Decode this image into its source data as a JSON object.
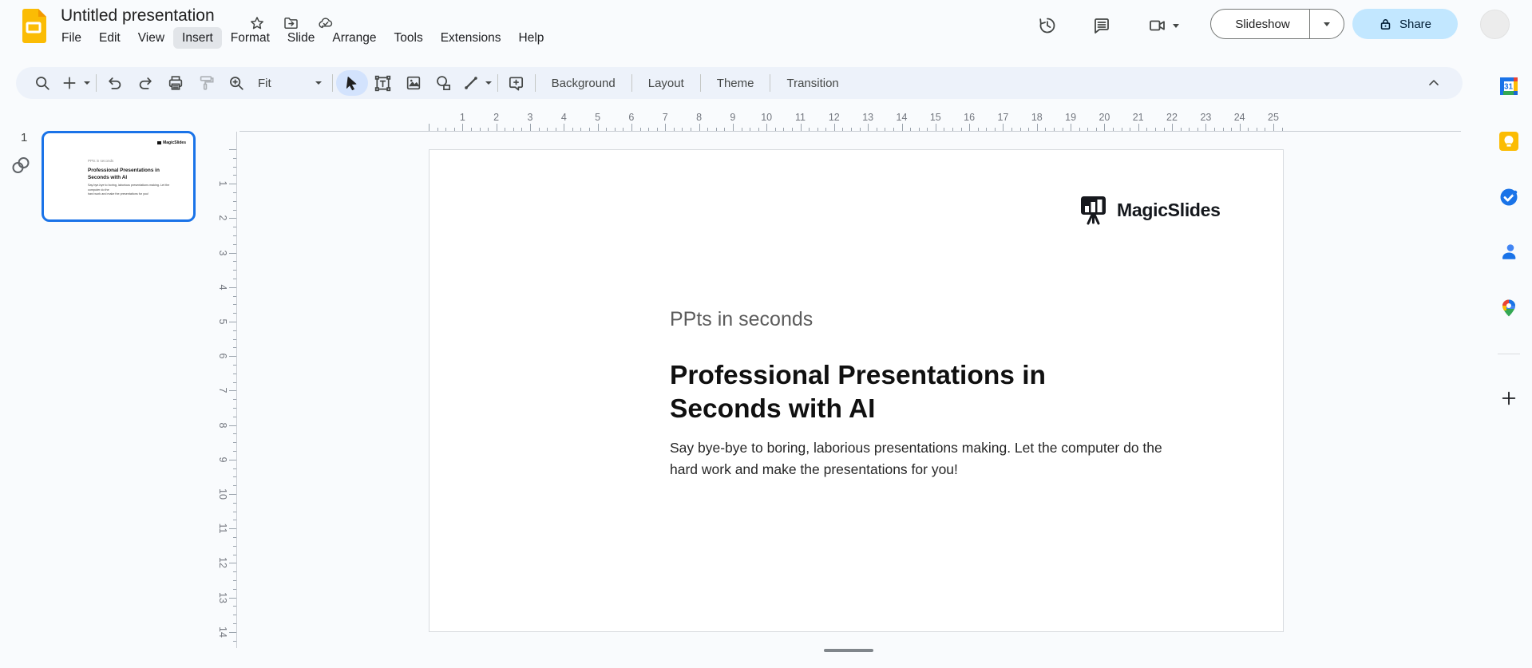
{
  "app": {
    "title": "Untitled presentation"
  },
  "menu": {
    "items": [
      "File",
      "Edit",
      "View",
      "Insert",
      "Format",
      "Slide",
      "Arrange",
      "Tools",
      "Extensions",
      "Help"
    ],
    "active_item": "Insert"
  },
  "header_actions": {
    "slideshow_label": "Slideshow",
    "share_label": "Share"
  },
  "toolbar": {
    "zoom_value": "Fit",
    "background_label": "Background",
    "layout_label": "Layout",
    "theme_label": "Theme",
    "transition_label": "Transition"
  },
  "filmstrip": {
    "slide_number": "1"
  },
  "rulers": {
    "horizontal_numbers": [
      1,
      2,
      3,
      4,
      5,
      6,
      7,
      8,
      9,
      10,
      11,
      12,
      13,
      14,
      15,
      16,
      17,
      18,
      19,
      20,
      21,
      22,
      23,
      24,
      25
    ],
    "vertical_numbers": [
      1,
      2,
      3,
      4,
      5,
      6,
      7,
      8,
      9,
      10,
      11,
      12,
      13,
      14
    ]
  },
  "slide": {
    "brand": "MagicSlides",
    "kicker": "PPts in seconds",
    "title_line1": "Professional Presentations in",
    "title_line2": "Seconds with AI",
    "body_line1": "Say bye-bye to boring, laborious presentations making. Let the computer do the",
    "body_line2": "hard work and make the presentations for you!"
  },
  "colors": {
    "toolbar_bg": "#edf2fa",
    "selected_tool_bg": "#d3e3fd",
    "share_bg": "#c2e7ff",
    "share_text": "#001d35",
    "thumb_selected_border": "#1a73e8",
    "icon_gray": "#444746",
    "slides_yellow": "#fbbc04"
  }
}
